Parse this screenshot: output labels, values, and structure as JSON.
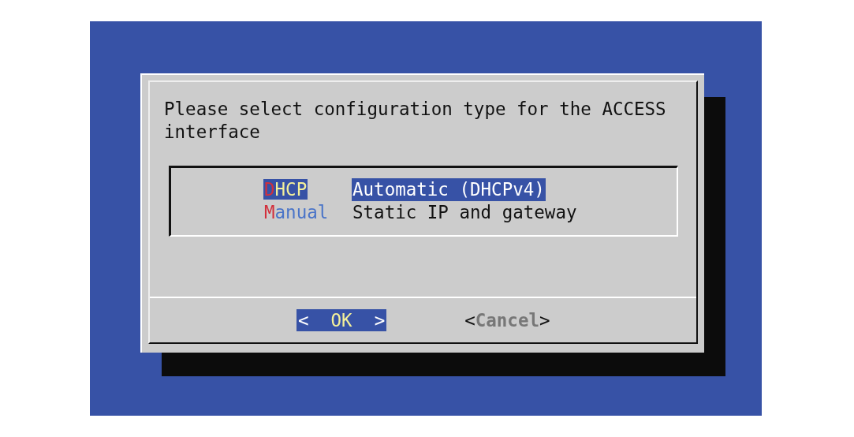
{
  "dialog": {
    "message": "Please select configuration type for the ACCESS interface",
    "menu": [
      {
        "tag": "DHCP",
        "description": "Automatic (DHCPv4)",
        "selected": true
      },
      {
        "tag": "Manual",
        "description": "Static IP and gateway",
        "selected": false
      }
    ],
    "buttons": [
      {
        "left": "<",
        "label": "OK",
        "right": ">",
        "selected": true
      },
      {
        "left": "<",
        "label": "Cancel",
        "right": ">",
        "selected": false
      }
    ]
  }
}
